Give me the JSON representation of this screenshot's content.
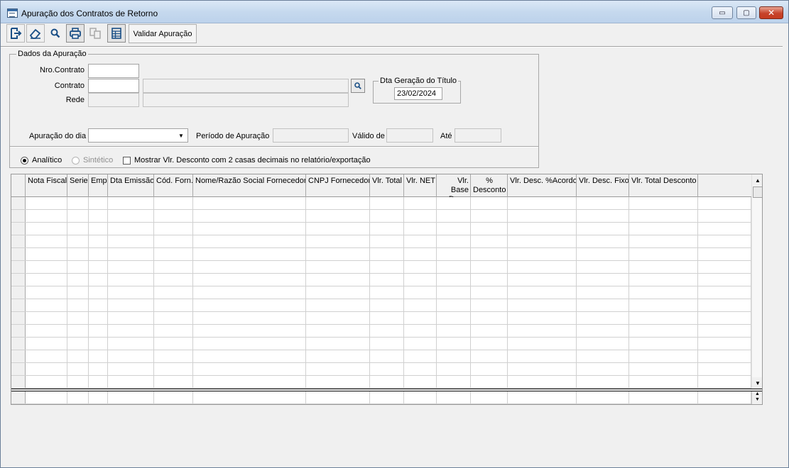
{
  "window": {
    "title": "Apuração dos Contratos de Retorno",
    "buttons": {
      "minimize": "▭",
      "maximize": "▢",
      "close": "✕"
    }
  },
  "toolbar": {
    "icons": [
      "exit-icon",
      "eraser-icon",
      "search-icon",
      "print-icon",
      "copy-icon",
      "table-icon"
    ],
    "validar_label": "Validar Apuração"
  },
  "dados": {
    "legend": "Dados da Apuração",
    "nro_contrato_label": "Nro.Contrato",
    "nro_contrato_value": "",
    "contrato_label": "Contrato",
    "contrato_value": "",
    "contrato_desc_value": "",
    "rede_label": "Rede",
    "rede_value": "",
    "rede_desc_value": "",
    "dta_geracao_legend": "Dta Geração do Título",
    "dta_geracao_value": "23/02/2024",
    "apuracao_dia_label": "Apuração do dia",
    "apuracao_dia_value": "",
    "periodo_label": "Período de Apuração",
    "periodo_value": "",
    "valido_label": "Válido de",
    "valido_value": "",
    "ate_label": "Até",
    "ate_value": ""
  },
  "options": {
    "analitico_label": "Analítico",
    "analitico_checked": true,
    "sintetico_label": "Sintético",
    "sintetico_enabled": false,
    "mostrar_label": "Mostrar Vlr. Desconto com 2 casas decimais no relatório/exportação",
    "mostrar_checked": false
  },
  "grid": {
    "columns": [
      "Nota Fiscal",
      "Serie",
      "Emp",
      "Dta Emissão",
      "Cód. Forn.",
      "Nome/Razão Social Fornecedor",
      "CNPJ Fornecedor",
      "Vlr. Total",
      "Vlr. NET",
      "Vlr. Base Desc.",
      "% Desconto",
      "Vlr. Desc. %Acordo",
      "Vlr. Desc. Fixo",
      "Vlr. Total Desconto"
    ],
    "rows": [],
    "scroll_up": "▲",
    "scroll_down": "▼"
  }
}
